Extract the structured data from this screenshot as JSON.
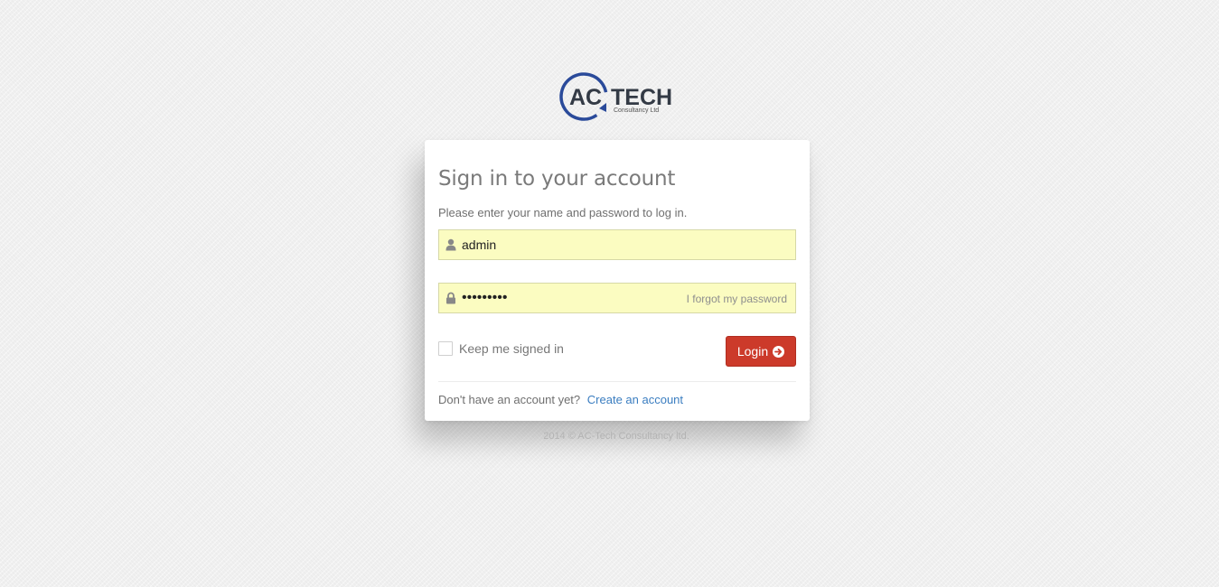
{
  "logo": {
    "text_ac": "AC",
    "text_tech": "TECH",
    "tagline": "Consultancy Ltd",
    "color": "#2a4a9a"
  },
  "login": {
    "title": "Sign in to your account",
    "subtitle": "Please enter your name and password to log in.",
    "username_value": "admin",
    "password_value": "•••••••••",
    "forgot_label": "I forgot my password",
    "keep_signed_in_label": "Keep me signed in",
    "keep_signed_in_checked": false,
    "login_label": "Login",
    "login_color": "#cc3a2a",
    "signup_prompt": "Don't have an account yet?",
    "signup_link": "Create an account",
    "field_bg": "#fbfcc1"
  },
  "icons": {
    "username": "user-icon",
    "password": "lock-icon",
    "login": "arrow-circle-right-icon"
  },
  "footer": {
    "text": "2014 © AC-Tech Consultancy ltd."
  }
}
